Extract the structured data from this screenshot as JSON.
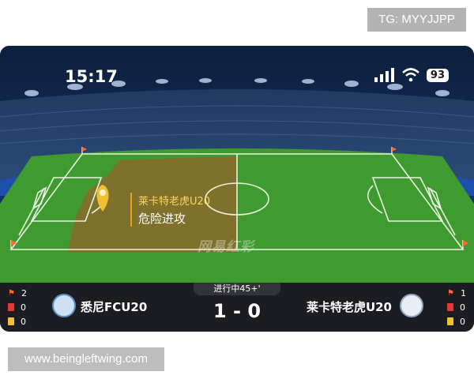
{
  "top_label": "TG: MYYJJPP",
  "bottom_watermark": "www.beingleftwing.com",
  "status_bar": {
    "time": "15:17",
    "battery": "93",
    "icons": [
      "signal-icon",
      "wifi-icon",
      "battery-icon"
    ]
  },
  "pitch": {
    "event_team": "莱卡特老虎U20",
    "event_text": "危险进攻",
    "brand": "网易红彩"
  },
  "match": {
    "period": "进行中45+'",
    "home": {
      "name": "悉尼FCU20",
      "corners": "2",
      "red_cards": "0",
      "yellow_cards": "0"
    },
    "away": {
      "name": "莱卡特老虎U20",
      "corners": "1",
      "red_cards": "0",
      "yellow_cards": "0"
    },
    "score_home": "1",
    "score_separator": "-",
    "score_away": "0"
  },
  "colors": {
    "pitch": "#3f9a2f",
    "danger_zone": "#8a6a2a",
    "red_card": "#e53935",
    "yellow_card": "#f2c230",
    "corner_flag": "#ff6a3a"
  }
}
